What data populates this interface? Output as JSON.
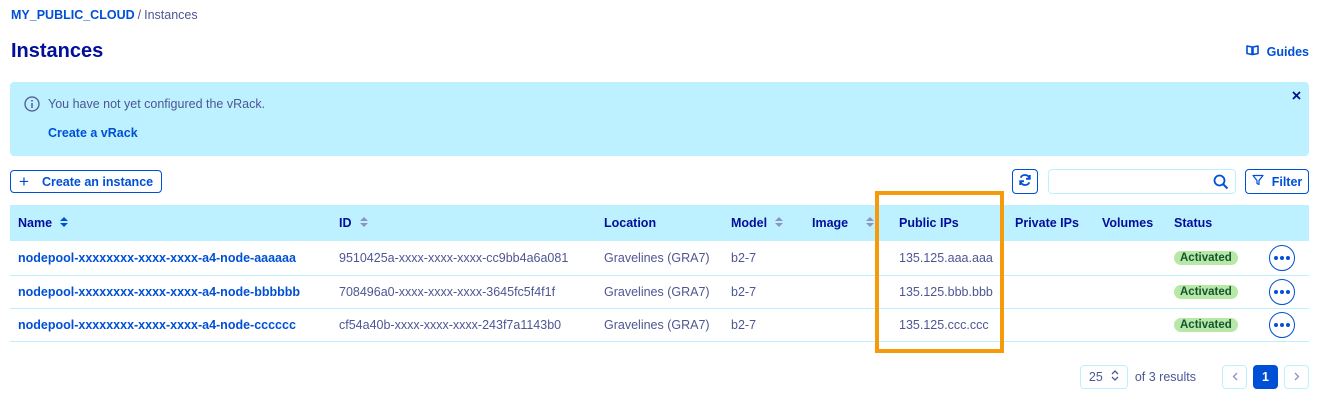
{
  "breadcrumb": {
    "project": "MY_PUBLIC_CLOUD",
    "separator": "/",
    "current": "Instances"
  },
  "title": "Instances",
  "guides": {
    "label": "Guides",
    "icon": "book-icon"
  },
  "banner": {
    "message": "You have not yet configured the vRack.",
    "link": "Create a vRack",
    "icons": [
      "info-icon",
      "close-icon"
    ]
  },
  "toolbar": {
    "create_label": "Create an instance",
    "search_placeholder": "",
    "filter_label": "Filter",
    "icons": [
      "plus-icon",
      "refresh-icon",
      "search-icon",
      "filter-icon"
    ]
  },
  "table": {
    "columns": [
      "Name",
      "ID",
      "Location",
      "Model",
      "Image",
      "Public IPs",
      "Private IPs",
      "Volumes",
      "Status"
    ],
    "rows": [
      {
        "name": "nodepool-xxxxxxxx-xxxx-xxxx-a4-node-aaaaaa",
        "id": "9510425a-xxxx-xxxx-xxxx-cc9bb4a6a081",
        "location": "Gravelines (GRA7)",
        "model": "b2-7",
        "image": "",
        "public_ips": "135.125.aaa.aaa",
        "private_ips": "",
        "volumes": "",
        "status": "Activated"
      },
      {
        "name": "nodepool-xxxxxxxx-xxxx-xxxx-a4-node-bbbbbb",
        "id": "708496a0-xxxx-xxxx-xxxx-3645fc5f4f1f",
        "location": "Gravelines (GRA7)",
        "model": "b2-7",
        "image": "",
        "public_ips": "135.125.bbb.bbb",
        "private_ips": "",
        "volumes": "",
        "status": "Activated"
      },
      {
        "name": "nodepool-xxxxxxxx-xxxx-xxxx-a4-node-cccccc",
        "id": "cf54a40b-xxxx-xxxx-xxxx-243f7a1143b0",
        "location": "Gravelines (GRA7)",
        "model": "b2-7",
        "image": "",
        "public_ips": "135.125.ccc.ccc",
        "private_ips": "",
        "volumes": "",
        "status": "Activated"
      }
    ]
  },
  "pagination": {
    "page_size": "25",
    "of_results": "of 3 results",
    "current_page": "1"
  },
  "colors": {
    "primary": "#0050d7",
    "title": "#000e9c",
    "banner": "#bef1ff",
    "success": "#b7e8a7",
    "highlight": "#f59a0b"
  }
}
